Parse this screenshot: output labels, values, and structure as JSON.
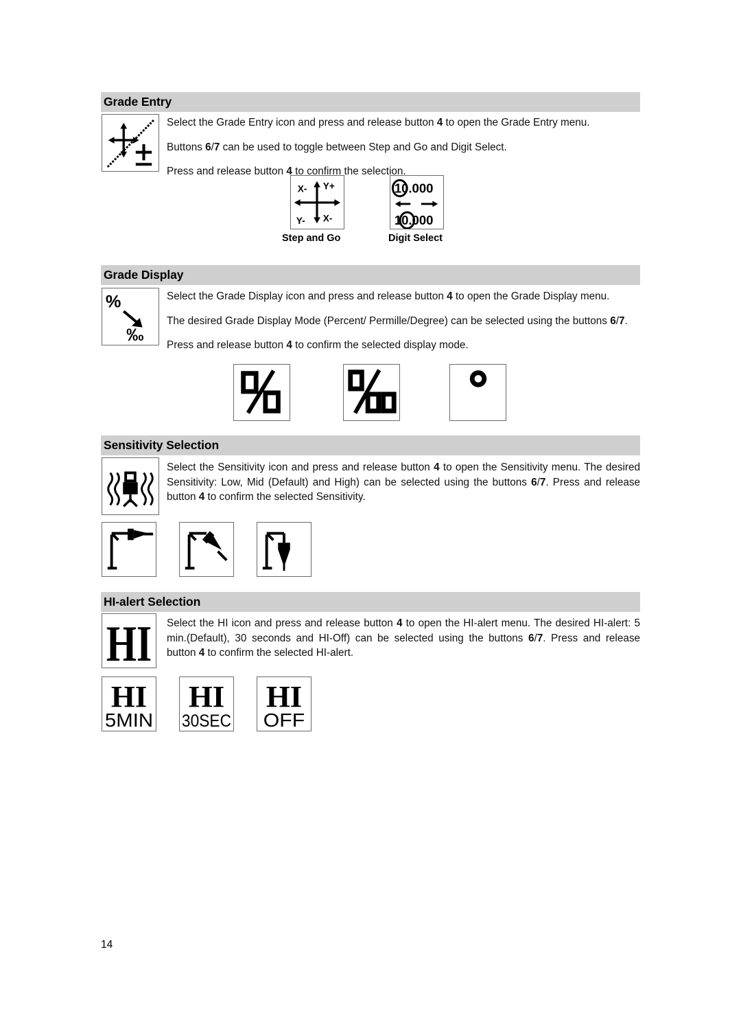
{
  "page": {
    "number": "14"
  },
  "sections": [
    {
      "id": "grade-entry",
      "title": "Grade Entry",
      "paragraphs": [
        "Select the Grade Entry icon and press and release button <b>4</b> to open the Grade Entry menu.",
        "Buttons <b>6</b>/<b>7</b> can be used to toggle between Step and Go and Digit Select.",
        "Press and release button <b>4</b> to confirm the selection."
      ],
      "main_icon": "grade-entry-icon",
      "options": [
        {
          "icon": "step-and-go-icon",
          "caption": "Step and Go"
        },
        {
          "icon": "digit-select-icon",
          "caption": "Digit Select"
        }
      ]
    },
    {
      "id": "grade-display",
      "title": "Grade Display",
      "paragraphs": [
        "Select the Grade Display icon and press and release button <b>4</b> to open the Grade Display menu.",
        "The desired Grade Display Mode (Percent/ Permille/Degree) can be selected using the buttons <b>6</b>/<b>7</b>.",
        "Press and release button <b>4</b> to confirm the selected display mode."
      ],
      "main_icon": "grade-display-icon",
      "options": [
        {
          "icon": "percent-icon",
          "caption": ""
        },
        {
          "icon": "permille-icon",
          "caption": ""
        },
        {
          "icon": "degree-icon",
          "caption": ""
        }
      ]
    },
    {
      "id": "sensitivity-selection",
      "title": "Sensitivity Selection",
      "paragraphs": [
        "Select the Sensitivity icon and press and release button <b>4</b> to open the Sensitivity menu. The desired Sensitivity: Low, Mid (Default) and High) can be selected using the buttons <b>6</b>/<b>7</b>. Press and release button <b>4</b> to confirm the selected Sensitivity."
      ],
      "main_icon": "sensitivity-icon",
      "options": [
        {
          "icon": "sensitivity-low-icon",
          "caption": ""
        },
        {
          "icon": "sensitivity-mid-icon",
          "caption": ""
        },
        {
          "icon": "sensitivity-high-icon",
          "caption": ""
        }
      ]
    },
    {
      "id": "hi-alert-selection",
      "title": "HI-alert Selection",
      "paragraphs": [
        "Select the HI icon and press and release button <b>4</b> to open the HI-alert menu. The desired HI-alert: 5 min.(Default), 30 seconds and HI-Off) can be selected using the buttons <b>6</b>/<b>7</b>. Press and release button <b>4</b> to confirm the selected HI-alert."
      ],
      "main_icon": "hi-icon",
      "options": [
        {
          "icon": "hi-5min-icon",
          "caption": "",
          "line1": "HI",
          "line2": "5MIN"
        },
        {
          "icon": "hi-30sec-icon",
          "caption": "",
          "line1": "HI",
          "line2": "30SEC"
        },
        {
          "icon": "hi-off-icon",
          "caption": "",
          "line1": "HI",
          "line2": "OFF"
        }
      ]
    }
  ],
  "glyph_text": {
    "step_and_go": {
      "x_minus_top": "X-",
      "y_plus": "Y+",
      "y_minus": "Y-",
      "x_minus_bottom": "X-"
    },
    "digit_select": {
      "row1": "10.000",
      "row2": "10.000",
      "highlight1": "1",
      "highlight2": "0"
    },
    "percent": "0/0",
    "permille": "0/00",
    "degree": "o",
    "hi": "HI"
  },
  "colors": {
    "header_bar": "#cfcfcf",
    "frame_border": "#6b6b6b",
    "text": "#111111",
    "glyph": "#000000"
  }
}
